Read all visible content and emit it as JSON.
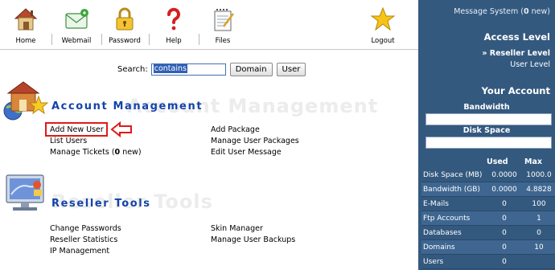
{
  "toolbar": {
    "items": [
      {
        "label": "Home",
        "icon": "house-icon"
      },
      {
        "label": "Webmail",
        "icon": "envelope-icon"
      },
      {
        "label": "Password",
        "icon": "padlock-icon"
      },
      {
        "label": "Help",
        "icon": "question-mark-icon"
      },
      {
        "label": "Files",
        "icon": "notepad-icon"
      },
      {
        "label": "Logout",
        "icon": "star-icon"
      }
    ]
  },
  "search": {
    "label": "Search:",
    "value": "contains",
    "domain_button": "Domain",
    "user_button": "User"
  },
  "account_management": {
    "title": "Account Management",
    "links_left": [
      "Add New User",
      "List Users"
    ],
    "manage_tickets_prefix": "Manage Tickets (",
    "manage_tickets_count": "0",
    "manage_tickets_suffix": " new)",
    "links_right": [
      "Add Package",
      "Manage User Packages",
      "Edit User Message"
    ]
  },
  "reseller_tools": {
    "title": "Reseller Tools",
    "links_left": [
      "Change Passwords",
      "Reseller Statistics",
      "IP Management"
    ],
    "links_right": [
      "Skin Manager",
      "Manage User Backups"
    ]
  },
  "sidebar": {
    "message_prefix": "Message System (",
    "message_count": "0",
    "message_suffix": " new)",
    "access_level_heading": "Access Level",
    "reseller_level": "» Reseller Level",
    "user_level": "User Level",
    "your_account_heading": "Your Account",
    "bandwidth_label": "Bandwidth",
    "bandwidth_fraction": 0,
    "disk_space_label": "Disk Space",
    "disk_space_fraction": 0,
    "col_used": "Used",
    "col_max": "Max",
    "stats": [
      {
        "name": "Disk Space (MB)",
        "used": "0.0000",
        "max": "1000.0"
      },
      {
        "name": "Bandwidth (GB)",
        "used": "0.0000",
        "max": "4.8828"
      },
      {
        "name": "E-Mails",
        "used": "0",
        "max": "100"
      },
      {
        "name": "Ftp Accounts",
        "used": "0",
        "max": "1"
      },
      {
        "name": "Databases",
        "used": "0",
        "max": "0"
      },
      {
        "name": "Domains",
        "used": "0",
        "max": "10"
      },
      {
        "name": "Users",
        "used": "0",
        "max": ""
      }
    ]
  },
  "colors": {
    "sidebar_bg": "#34597f",
    "section_title": "#1443a8",
    "highlight_red": "#e01919"
  }
}
